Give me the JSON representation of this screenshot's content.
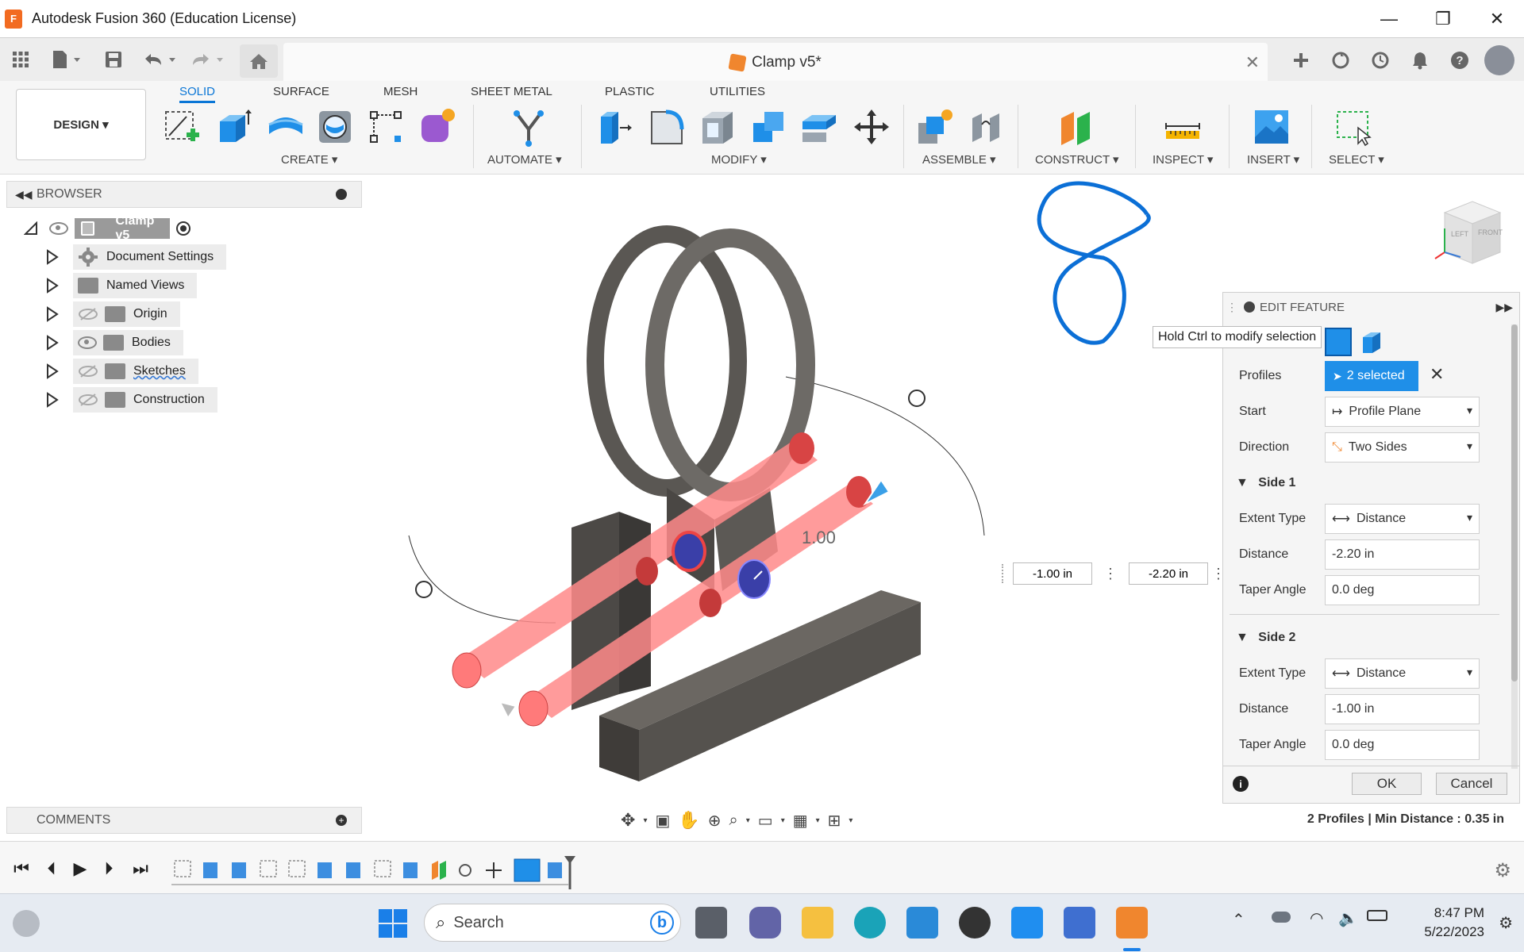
{
  "window": {
    "title": "Autodesk Fusion 360 (Education License)",
    "minimize_glyph": "—",
    "restore_glyph": "❐",
    "close_glyph": "✕"
  },
  "document": {
    "tab_title": "Clamp v5*",
    "tab_close": "✕"
  },
  "ribbon": {
    "workspace": "DESIGN ▾",
    "tabs": [
      "SOLID",
      "SURFACE",
      "MESH",
      "SHEET METAL",
      "PLASTIC",
      "UTILITIES"
    ],
    "active_tab": "SOLID",
    "groups": [
      "CREATE ▾",
      "AUTOMATE ▾",
      "MODIFY ▾",
      "ASSEMBLE ▾",
      "CONSTRUCT ▾",
      "INSPECT ▾",
      "INSERT ▾",
      "SELECT ▾"
    ]
  },
  "browser": {
    "title": "BROWSER",
    "root": "Clamp v5",
    "items": [
      {
        "label": "Document Settings",
        "icon": "gear-icon"
      },
      {
        "label": "Named Views",
        "icon": "folder-icon"
      },
      {
        "label": "Origin",
        "icon": "folder-icon",
        "visibility": "hidden"
      },
      {
        "label": "Bodies",
        "icon": "folder-icon",
        "visibility": "visible"
      },
      {
        "label": "Sketches",
        "icon": "folder-icon",
        "visibility": "hidden"
      },
      {
        "label": "Construction",
        "icon": "folder-icon",
        "visibility": "hidden"
      }
    ]
  },
  "comments": {
    "title": "COMMENTS"
  },
  "viewport": {
    "dim_label": "1.00",
    "input_side1": "-1.00 in",
    "input_side2": "-2.20 in",
    "tooltip": "Hold Ctrl to modify selection",
    "status": "2 Profiles | Min Distance : 0.35 in",
    "viewcube_left": "LEFT",
    "viewcube_front": "FRONT"
  },
  "edit_feature": {
    "title": "EDIT FEATURE",
    "profiles_label": "Profiles",
    "profiles_value": "2 selected",
    "start_label": "Start",
    "start_value": "Profile Plane",
    "direction_label": "Direction",
    "direction_value": "Two Sides",
    "side1": {
      "title": "Side 1",
      "extent_label": "Extent Type",
      "extent_value": "Distance",
      "distance_label": "Distance",
      "distance_value": "-2.20 in",
      "taper_label": "Taper Angle",
      "taper_value": "0.0 deg"
    },
    "side2": {
      "title": "Side 2",
      "extent_label": "Extent Type",
      "extent_value": "Distance",
      "distance_label": "Distance",
      "distance_value": "-1.00 in",
      "taper_label": "Taper Angle",
      "taper_value": "0.0 deg"
    },
    "ok": "OK",
    "cancel": "Cancel"
  },
  "taskbar": {
    "search": "Search",
    "time": "8:47 PM",
    "date": "5/22/2023"
  },
  "colors": {
    "accent": "#0a76d6",
    "body": "#5c5955",
    "extrude_preview": "#ff8a8a",
    "pen_annotation": "#0b6fd6"
  }
}
